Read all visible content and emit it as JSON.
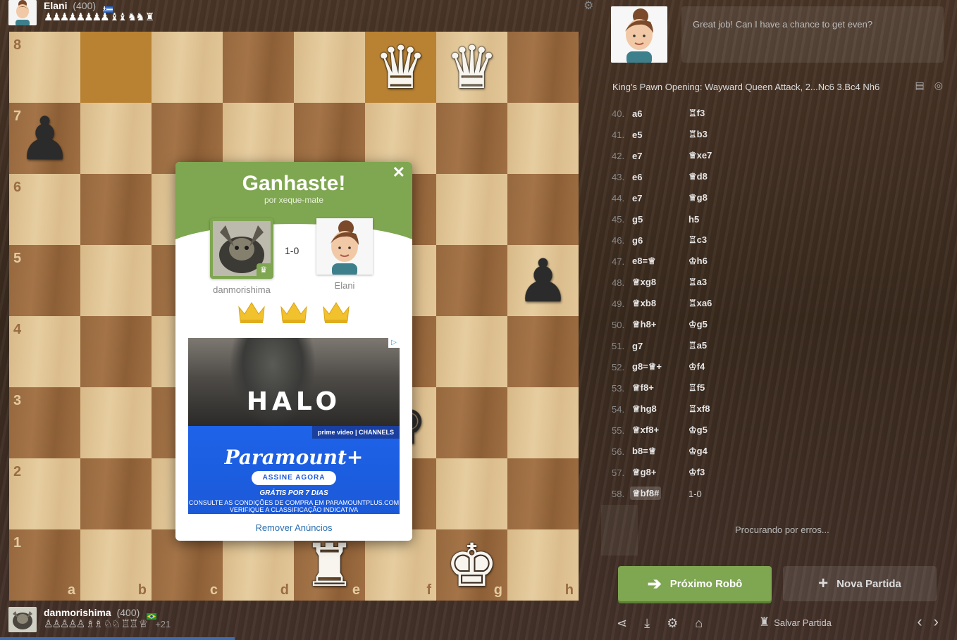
{
  "top_player": {
    "name": "Elani",
    "rating": "(400)",
    "captured": "♟♟♟♟♟♟♟♟ ♝♝ ♞♞ ♜"
  },
  "bottom_player": {
    "name": "danmorishima",
    "rating": "(400)",
    "captured": "♙♙♙♙♙ ♗♗ ♘♘ ♖♖ ♕",
    "advantage": "+21"
  },
  "board": {
    "ranks": [
      "8",
      "7",
      "6",
      "5",
      "4",
      "3",
      "2",
      "1"
    ],
    "files": [
      "a",
      "b",
      "c",
      "d",
      "e",
      "f",
      "g",
      "h"
    ]
  },
  "modal": {
    "title": "Ganhaste!",
    "subtitle": "por xeque-mate",
    "winner_name": "danmorishima",
    "loser_name": "Elani",
    "score": "1-0",
    "remove_ads": "Remover Anúncios",
    "ad": {
      "headline": "HALO",
      "network": "prime video | CHANNELS",
      "brand": "Paramount+",
      "cta": "ASSINE AGORA",
      "offer": "GRÁTIS POR 7 DIAS",
      "legal1": "CONSULTE AS CONDIÇÕES DE COMPRA EM PARAMOUNTPLUS.COM",
      "legal2": "VERIFIQUE A CLASSIFICAÇÃO INDICATIVA"
    }
  },
  "coach": {
    "message": "Great job! Can I have a chance to get even?"
  },
  "opening": "King's Pawn Opening: Wayward Queen Attack, 2...Nc6 3.Bc4 Nh6",
  "moves": [
    {
      "n": "40.",
      "w": "a6",
      "b": "♖f3"
    },
    {
      "n": "41.",
      "w": "e5",
      "b": "♖b3"
    },
    {
      "n": "42.",
      "w": "e7",
      "b": "♕xe7"
    },
    {
      "n": "43.",
      "w": "e6",
      "b": "♕d8"
    },
    {
      "n": "44.",
      "w": "e7",
      "b": "♕g8"
    },
    {
      "n": "45.",
      "w": "g5",
      "b": "h5"
    },
    {
      "n": "46.",
      "w": "g6",
      "b": "♖c3"
    },
    {
      "n": "47.",
      "w": "e8=♕",
      "b": "♔h6"
    },
    {
      "n": "48.",
      "w": "♕xg8",
      "b": "♖a3"
    },
    {
      "n": "49.",
      "w": "♕xb8",
      "b": "♖xa6"
    },
    {
      "n": "50.",
      "w": "♕h8+",
      "b": "♔g5"
    },
    {
      "n": "51.",
      "w": "g7",
      "b": "♖a5"
    },
    {
      "n": "52.",
      "w": "g8=♕+",
      "b": "♔f4"
    },
    {
      "n": "53.",
      "w": "♕f8+",
      "b": "♖f5"
    },
    {
      "n": "54.",
      "w": "♕hg8",
      "b": "♖xf8"
    },
    {
      "n": "55.",
      "w": "♕xf8+",
      "b": "♔g5"
    },
    {
      "n": "56.",
      "w": "b8=♕",
      "b": "♔g4"
    },
    {
      "n": "57.",
      "w": "♕g8+",
      "b": "♔f3"
    },
    {
      "n": "58.",
      "w": "♕bf8#",
      "b": "1-0"
    }
  ],
  "status": "Procurando por erros...",
  "buttons": {
    "next_bot": "Próximo Robô",
    "new_game": "Nova Partida",
    "save_game": "Salvar Partida"
  },
  "colors": {
    "accent_green": "#7fa650",
    "light_square": "#e6cd9f",
    "dark_square": "#a47448"
  }
}
